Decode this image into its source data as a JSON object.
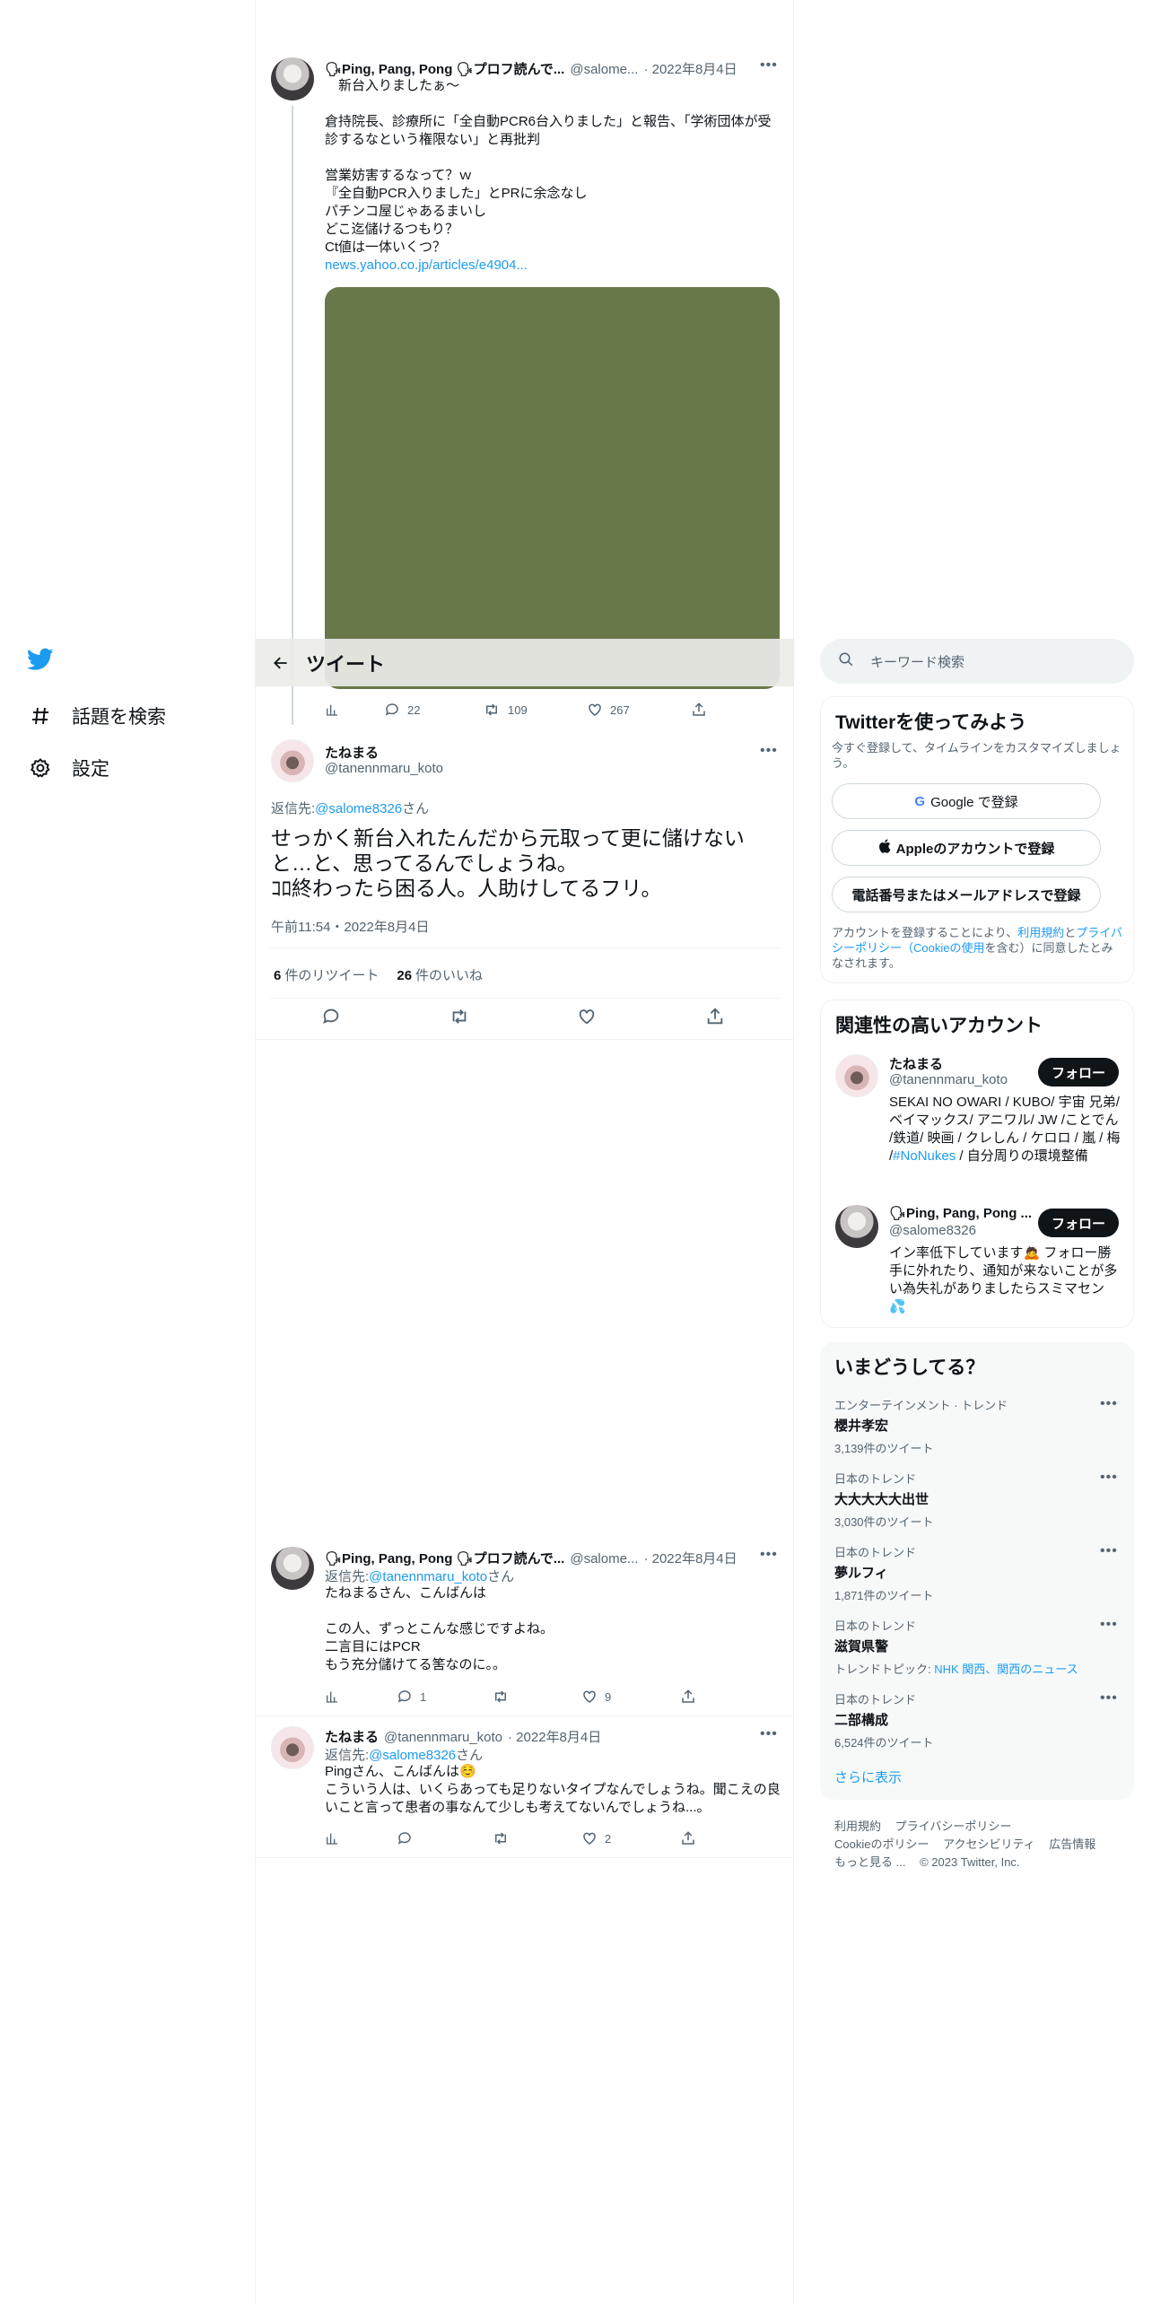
{
  "nav": {
    "items": [
      {
        "label": "話題を検索"
      },
      {
        "label": "設定"
      }
    ]
  },
  "header": {
    "title": "ツイート"
  },
  "tweet1": {
    "name": "🗣Ping, Pang, Pong 🗣プロフ読んで...",
    "handle": "@salome...",
    "date": "· 2022年8月4日",
    "text": "　新台入りましたぁ〜\n\n倉持院長、診療所に「全自動PCR6台入りました」と報告、「学術団体が受診するなという権限ない」と再批判\n\n営業妨害するなって？ｗ\n『全自動PCR入りました」とPRに余念なし\nパチンコ屋じゃあるまいし\nどこ迄儲けるつもり？\nCt値は一体いくつ？",
    "link": "news.yahoo.co.jp/articles/e4904...",
    "replies": "22",
    "retweets": "109",
    "likes": "267"
  },
  "focus": {
    "name": "たねまる",
    "handle": "@tanennmaru_koto",
    "reply_prefix": "返信先: ",
    "reply_to": "@salome8326",
    "reply_suffix": "さん",
    "text": "せっかく新台入れたんだから元取って更に儲けないと…と、思ってるんでしょうね。\nｺﾛ終わったら困る人。人助けしてるフリ。",
    "time": "午前11:54・2022年8月4日",
    "retweet_count": "6",
    "retweet_label": "件のリツイート",
    "like_count": "26",
    "like_label": "件のいいね"
  },
  "reply1": {
    "name": "🗣Ping, Pang, Pong 🗣プロフ読んで...",
    "handle": "@salome...",
    "date": "· 2022年8月4日",
    "reply_prefix": "返信先: ",
    "reply_to": "@tanennmaru_koto",
    "reply_suffix": "さん",
    "text": "たねまるさん、こんばんは\n\nこの人、ずっとこんな感じですよね。\n二言目にはPCR\nもう充分儲けてる筈なのに。。",
    "replies": "1",
    "likes": "9"
  },
  "reply2": {
    "name": "たねまる",
    "handle": "@tanennmaru_koto",
    "date": "· 2022年8月4日",
    "reply_prefix": "返信先: ",
    "reply_to": "@salome8326",
    "reply_suffix": "さん",
    "text": "Pingさん、こんばんは☺️\nこういう人は、いくらあっても足りないタイプなんでしょうね。聞こえの良いこと言って患者の事なんて少しも考えてないんでしょうね...。",
    "likes": "2"
  },
  "search": {
    "placeholder": "キーワード検索"
  },
  "signup": {
    "title": "Twitterを使ってみよう",
    "subtitle": "今すぐ登録して、タイムラインをカスタマイズしましょう。",
    "google": "Google で登録",
    "apple": "Appleのアカウントで登録",
    "phone": "電話番号またはメールアドレスで登録",
    "terms_1": "アカウントを登録することにより、",
    "terms_link1": "利用規約",
    "terms_2": "と",
    "terms_link2": "プライバシーポリシー（Cookieの使用",
    "terms_3": "を含む）に同意したとみなされます。"
  },
  "related": {
    "title": "関連性の高いアカウント",
    "accounts": [
      {
        "name": "たねまる",
        "handle": "@tanennmaru_koto",
        "follow": "フォロー",
        "bio_1": "SEKAI NO OWARI / KUBO/ 宇宙 兄弟/ ベイマックス/ アニワル/ JW /ことでん /鉄道/ 映画 / クレしん / ケロロ / 嵐 / 梅 /",
        "bio_tag": "#NoNukes",
        "bio_2": " / 自分周りの環境整備"
      },
      {
        "name": "🗣Ping, Pang, Pong ...",
        "handle": "@salome8326",
        "follow": "フォロー",
        "bio_1": "イン率低下しています🙇 フォロー勝手に外れたり、通知が来ないことが多い為失礼がありましたらスミマセン💦"
      }
    ]
  },
  "trends": {
    "title": "いまどうしてる？",
    "items": [
      {
        "category": "エンターテインメント · トレンド",
        "name": "櫻井孝宏",
        "count": "3,139件のツイート"
      },
      {
        "category": "日本のトレンド",
        "name": "大大大大大出世",
        "count": "3,030件のツイート"
      },
      {
        "category": "日本のトレンド",
        "name": "夢ルフィ",
        "count": "1,871件のツイート"
      },
      {
        "category": "日本のトレンド",
        "name": "滋賀県警",
        "topic_label": "トレンドトピック: ",
        "topic": "NHK 関西、関西のニュース"
      },
      {
        "category": "日本のトレンド",
        "name": "二部構成",
        "count": "6,524件のツイート"
      }
    ],
    "show_more": "さらに表示"
  },
  "footer": {
    "links": [
      "利用規約",
      "プライバシーポリシー",
      "Cookieのポリシー",
      "アクセシビリティ",
      "広告情報",
      "もっと見る ..."
    ],
    "copyright": "© 2023 Twitter, Inc."
  },
  "colors": {
    "accent": "#1d9bf0",
    "media": "#69784a",
    "text": "#0f1419",
    "muted": "#536471"
  }
}
